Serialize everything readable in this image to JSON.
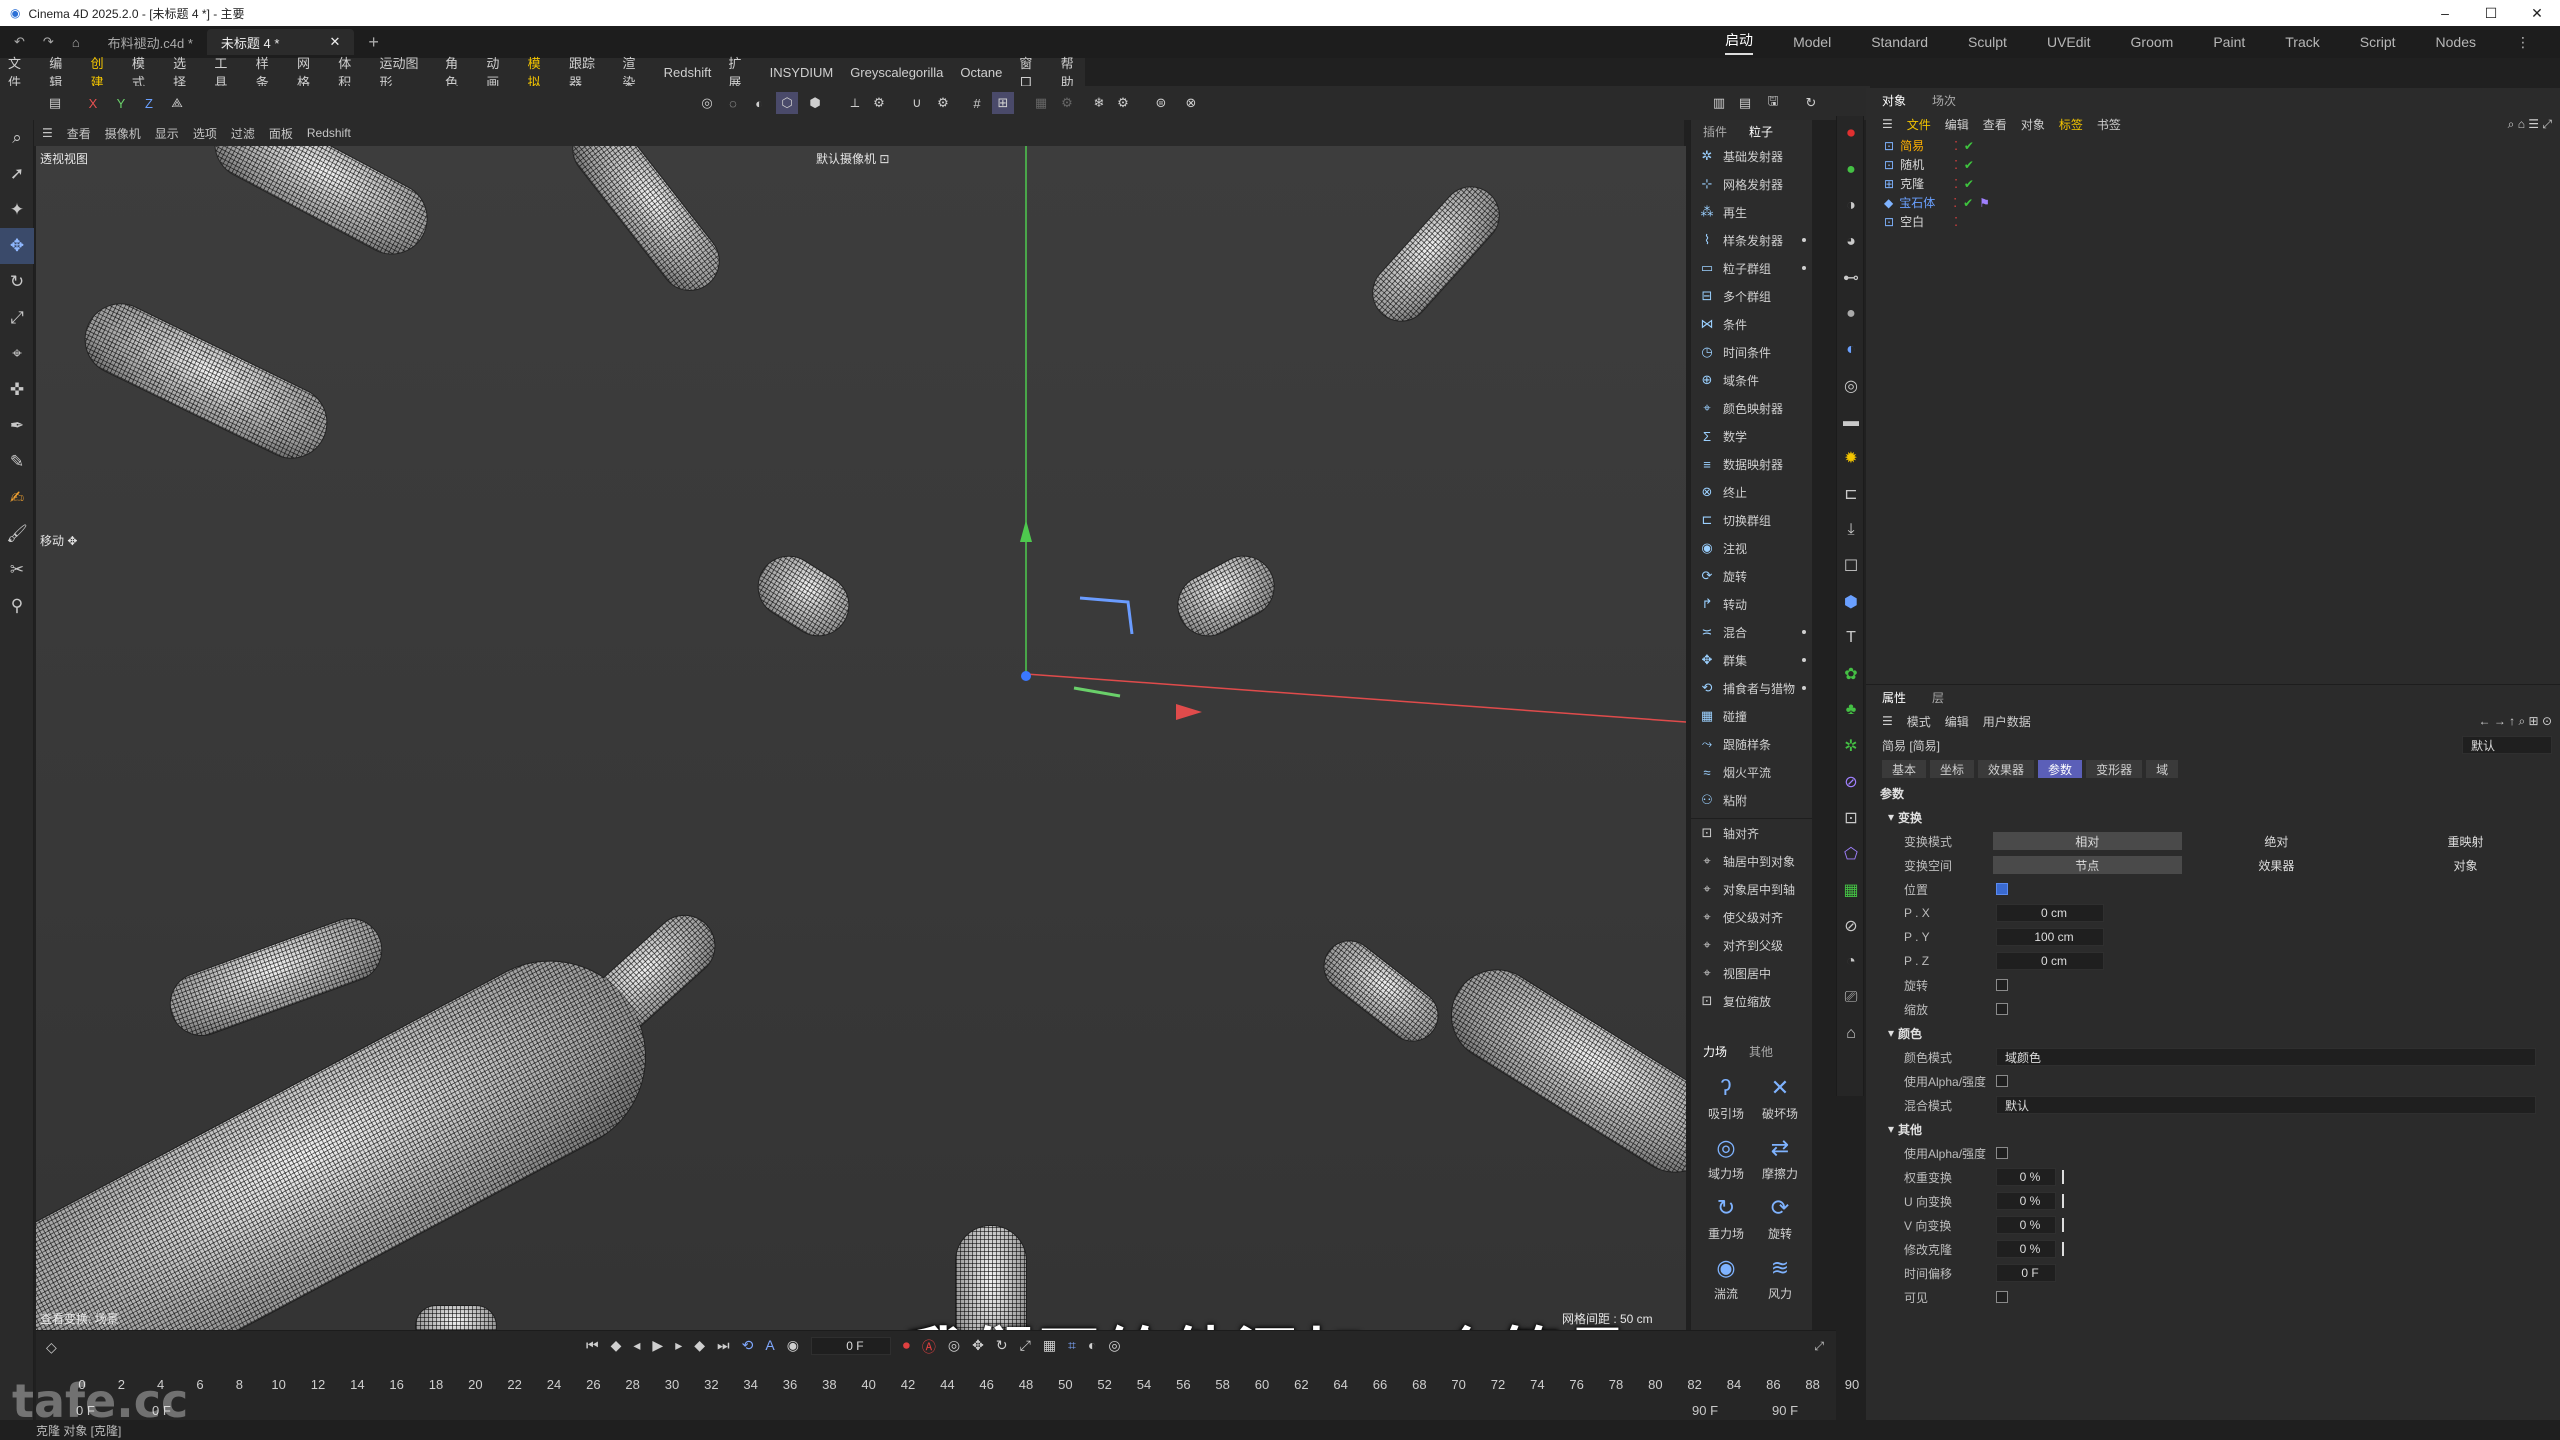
{
  "app": {
    "title": "Cinema 4D 2025.2.0 - [未标题 4 *] - 主要",
    "window_controls": [
      "–",
      "☐",
      "✕"
    ]
  },
  "tabs": {
    "file1": "布料褪动.c4d *",
    "file2": "未标题 4 *",
    "new_tab": "+"
  },
  "layouts": [
    "启动",
    "Model",
    "Standard",
    "Sculpt",
    "UVEdit",
    "Groom",
    "Paint",
    "Track",
    "Script",
    "Nodes"
  ],
  "menu": [
    "文件",
    "编辑",
    "创建",
    "模式",
    "选择",
    "工具",
    "样条",
    "网格",
    "体积",
    "运动图形",
    "角色",
    "动画",
    "模拟",
    "跟踪器",
    "渲染",
    "Redshift",
    "扩展",
    "INSYDIUM",
    "Greyscalegorilla",
    "Octane",
    "窗口",
    "帮助"
  ],
  "menu_highlight": [
    "创建",
    "模拟"
  ],
  "axes": {
    "x": "X",
    "y": "Y",
    "z": "Z"
  },
  "viewport": {
    "menu": [
      "查看",
      "摄像机",
      "显示",
      "选项",
      "过滤",
      "面板",
      "Redshift"
    ],
    "name": "透视视图",
    "camera": "默认摄像机 ⊡",
    "move_label": "移动 ✥",
    "bottom_left": "查看变换: 场景",
    "grid": "网格间距 : 50 cm"
  },
  "subtitle": "我们再给他添加一个简易",
  "plugins": {
    "tabs": [
      "插件",
      "粒子"
    ],
    "items": [
      {
        "label": "基础发射器",
        "dot": false
      },
      {
        "label": "网格发射器",
        "dot": false
      },
      {
        "label": "再生",
        "dot": false
      },
      {
        "label": "样条发射器",
        "dot": true
      },
      {
        "label": "粒子群组",
        "dot": true
      },
      {
        "label": "多个群组",
        "dot": false
      },
      {
        "label": "条件",
        "dot": false
      },
      {
        "label": "时间条件",
        "dot": false
      },
      {
        "label": "域条件",
        "dot": false
      },
      {
        "label": "颜色映射器",
        "dot": false
      },
      {
        "label": "数学",
        "dot": false
      },
      {
        "label": "数据映射器",
        "dot": false
      },
      {
        "label": "终止",
        "dot": false
      },
      {
        "label": "切换群组",
        "dot": false
      },
      {
        "label": "注视",
        "dot": false
      },
      {
        "label": "旋转",
        "dot": false
      },
      {
        "label": "转动",
        "dot": false
      },
      {
        "label": "混合",
        "dot": true
      },
      {
        "label": "群集",
        "dot": true
      },
      {
        "label": "捕食者与猎物",
        "dot": true
      },
      {
        "label": "碰撞",
        "dot": false
      },
      {
        "label": "跟随样条",
        "dot": false
      },
      {
        "label": "烟火平流",
        "dot": false
      },
      {
        "label": "粘附",
        "dot": false
      }
    ],
    "align": [
      "轴对齐",
      "轴居中到对象",
      "对象居中到轴",
      "使父级对齐",
      "对齐到父级",
      "视图居中",
      "复位缩放"
    ]
  },
  "forces": {
    "tabs": [
      "力场",
      "其他"
    ],
    "items": [
      "吸引场",
      "破坏场",
      "域力场",
      "摩擦力",
      "重力场",
      "旋转",
      "湍流",
      "风力"
    ]
  },
  "objects": {
    "tabs": [
      "对象",
      "场次"
    ],
    "menu": [
      "文件",
      "编辑",
      "查看",
      "对象",
      "标签",
      "书签"
    ],
    "menu_highlight": [
      "文件",
      "标签"
    ],
    "rows": [
      {
        "name": "简易",
        "selected": true
      },
      {
        "name": "随机",
        "selected": false
      },
      {
        "name": "克隆",
        "selected": false
      },
      {
        "name": "宝石体",
        "selected": false
      },
      {
        "name": "空白",
        "selected": false
      }
    ]
  },
  "attributes": {
    "tabs": [
      "属性",
      "层"
    ],
    "menu": [
      "模式",
      "编辑",
      "用户数据"
    ],
    "object_name": "简易 [简易]",
    "preset": "默认",
    "subtabs": [
      "基本",
      "坐标",
      "效果器",
      "参数",
      "变形器",
      "域"
    ],
    "active_subtab": "参数",
    "params_title": "参数",
    "transform_section": "变换",
    "transform_mode_label": "变换模式",
    "transform_mode": [
      "相对",
      "绝对",
      "重映射"
    ],
    "transform_space_label": "变换空间",
    "transform_space": [
      "节点",
      "效果器",
      "对象"
    ],
    "position_label": "位置",
    "px_label": "P . X",
    "px": "0 cm",
    "py_label": "P . Y",
    "py": "100 cm",
    "pz_label": "P . Z",
    "pz": "0 cm",
    "rotate_label": "旋转",
    "scale_label": "缩放",
    "color_section": "颜色",
    "color_mode_label": "颜色模式",
    "color_mode": "域颜色",
    "use_alpha_label": "使用Alpha/强度",
    "blend_mode_label": "混合模式",
    "blend_mode": "默认",
    "other_section": "其他",
    "use_alpha2_label": "使用Alpha/强度",
    "weight_label": "权重变换",
    "weight": "0 %",
    "u_label": "U 向变换",
    "u": "0 %",
    "v_label": "V 向变换",
    "v": "0 %",
    "clone_label": "修改克隆",
    "clone": "0 %",
    "time_label": "时间偏移",
    "time": "0 F",
    "visible_label": "可见"
  },
  "timeline": {
    "current_frame": "0 F",
    "ticks": [
      "0",
      "2",
      "4",
      "6",
      "8",
      "10",
      "12",
      "14",
      "16",
      "18",
      "20",
      "22",
      "24",
      "26",
      "28",
      "30",
      "32",
      "34",
      "36",
      "38",
      "40",
      "42",
      "44",
      "46",
      "48",
      "50",
      "52",
      "54",
      "56",
      "58",
      "60",
      "62",
      "64",
      "66",
      "68",
      "70",
      "72",
      "74",
      "76",
      "78",
      "80",
      "82",
      "84",
      "86",
      "88",
      "90"
    ],
    "start": "0 F",
    "start2": "0 F",
    "end": "90 F",
    "end2": "90 F"
  },
  "status": "克隆 对象 [克隆]",
  "watermark": "tafe.cc"
}
